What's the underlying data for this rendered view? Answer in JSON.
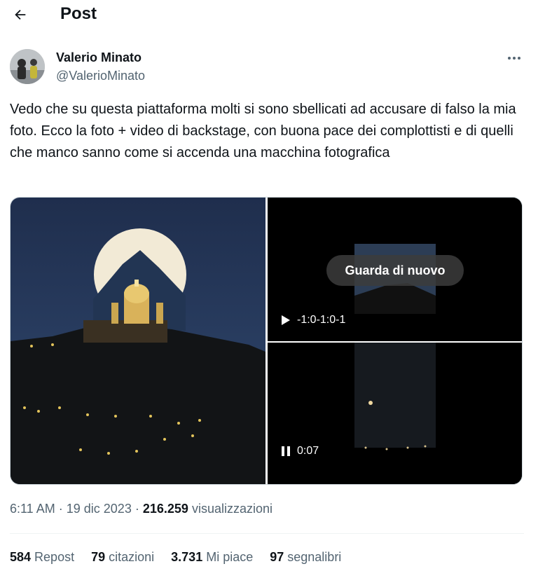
{
  "header": {
    "title": "Post",
    "back_icon": "arrow-left-icon"
  },
  "post": {
    "author_name": "Valerio Minato",
    "author_handle": "@ValerioMinato",
    "text": "Vedo che su questa piattaforma molti si sono sbellicati ad accusare di falso la mia foto. Ecco la foto + video di backstage, con buona pace dei complottisti e di quelli che manco sanno come si accenda una macchina fotografica",
    "more_icon": "more-horizontal-icon",
    "media": {
      "photo_alt_icon": "moon-over-basilica-photo",
      "video1": {
        "overlay": "Guarda di nuovo",
        "time": "-1:0-1:0-1",
        "state": "play-icon"
      },
      "video2": {
        "time": "0:07",
        "state": "pause-icon"
      }
    },
    "time": "6:11 AM",
    "date": "19 dic 2023",
    "views_count": "216.259",
    "views_label": "visualizzazioni",
    "separator": "·"
  },
  "stats": {
    "reposts_count": "584",
    "reposts_label": "Repost",
    "quotes_count": "79",
    "quotes_label": "citazioni",
    "likes_count": "3.731",
    "likes_label": "Mi piace",
    "bookmarks_count": "97",
    "bookmarks_label": "segnalibri"
  },
  "colors": {
    "text": "#0f1419",
    "secondary": "#536471",
    "border": "#cfd9de"
  }
}
